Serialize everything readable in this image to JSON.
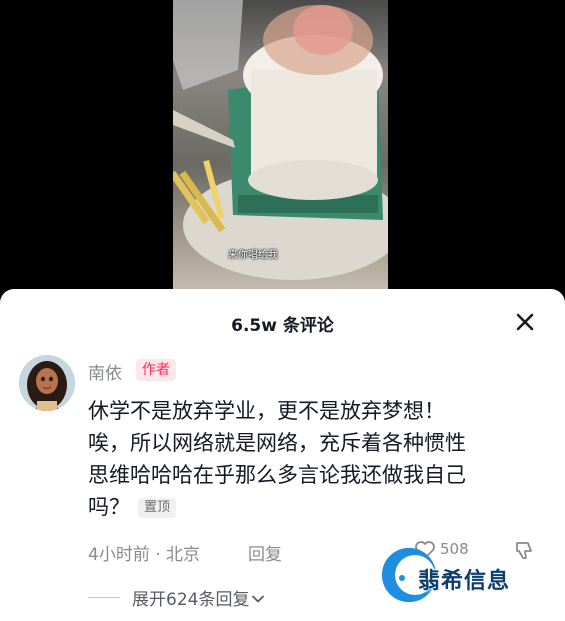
{
  "video": {
    "subtitle": "来你唱给我"
  },
  "comments_panel": {
    "title": "6.5w 条评论",
    "close_icon": "close-icon",
    "comment": {
      "author": "南依",
      "author_badge": "作者",
      "text_lines": [
        "休学不是放弃学业，更不是放弃梦想！",
        "唉，所以网络就是网络，充斥着各种惯性",
        "思维哈哈哈在乎那么多言论我还做我自己",
        "吗？"
      ],
      "pin_label": "置顶",
      "meta": "4小时前 · 北京",
      "reply_label": "回复",
      "like_count": "508"
    },
    "expand_replies": "展开624条回复"
  },
  "watermark": {
    "text": "翡希信息"
  },
  "colors": {
    "accent": "#fe2c55",
    "text_primary": "#161823",
    "text_secondary": "#8a8b91",
    "watermark_blue": "#1f8de0"
  }
}
